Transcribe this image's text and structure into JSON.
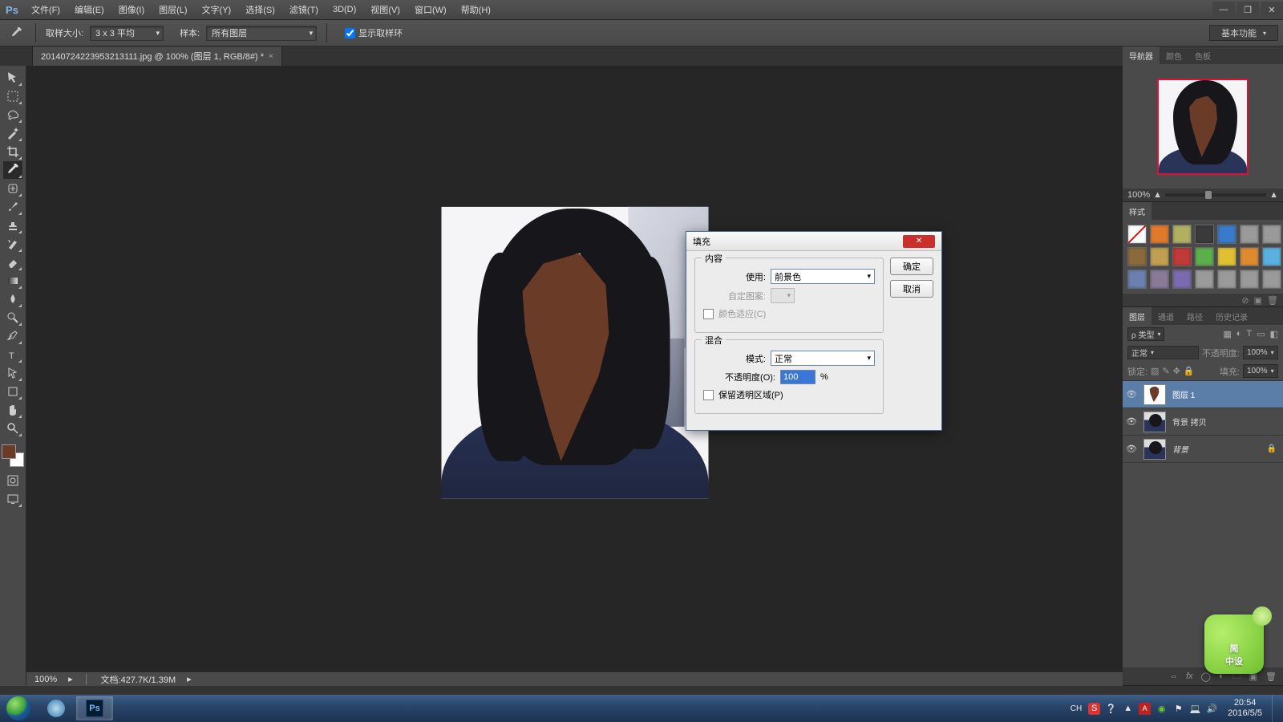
{
  "menubar": {
    "items": [
      "文件(F)",
      "编辑(E)",
      "图像(I)",
      "图层(L)",
      "文字(Y)",
      "选择(S)",
      "滤镜(T)",
      "3D(D)",
      "视图(V)",
      "窗口(W)",
      "帮助(H)"
    ]
  },
  "options_bar": {
    "sample_size_label": "取样大小:",
    "sample_size_value": "3 x 3 平均",
    "sample_label": "样本:",
    "sample_value": "所有图层",
    "show_ring_label": "显示取样环",
    "show_ring_checked": true,
    "workspace": "基本功能"
  },
  "doc_tab": {
    "title": "20140724223953213111.jpg @ 100% (图层 1, RGB/8#) *"
  },
  "dialog": {
    "title": "填充",
    "ok": "确定",
    "cancel": "取消",
    "group_content": "内容",
    "use_label": "使用:",
    "use_value": "前景色",
    "custom_pattern_label": "自定图案:",
    "color_adapt_label": "颜色适应(C)",
    "group_blend": "混合",
    "mode_label": "模式:",
    "mode_value": "正常",
    "opacity_label": "不透明度(O):",
    "opacity_value": "100",
    "opacity_pct": "%",
    "preserve_trans_label": "保留透明区域(P)"
  },
  "navigator": {
    "tabs": [
      "导航器",
      "颜色",
      "色板"
    ],
    "zoom": "100%"
  },
  "styles": {
    "tabs": [
      "样式"
    ],
    "colors": [
      "#ffffff",
      "#e07a2a",
      "#b0b060",
      "#3a3a3a",
      "#3a7acc",
      "#9a9a9a",
      "#9a9a9a",
      "#8a6a3a",
      "#c0a050",
      "#c03a3a",
      "#5ab04a",
      "#e0c030",
      "#e08a30",
      "#5ab0e0",
      "#6a80b0",
      "#8a7a9a",
      "#7a6ab0",
      "#9a9a9a",
      "#9a9a9a",
      "#9a9a9a",
      "#9a9a9a"
    ]
  },
  "layers": {
    "tabs": [
      "图层",
      "通道",
      "路径",
      "历史记录"
    ],
    "kind_label": "ρ 类型",
    "blend_mode": "正常",
    "opacity_label": "不透明度:",
    "opacity_value": "100%",
    "lock_label": "锁定:",
    "fill_label": "填充:",
    "fill_value": "100%",
    "items": [
      {
        "name": "图层 1",
        "thumb": "face",
        "selected": true,
        "locked": false,
        "visible": true,
        "italic": false
      },
      {
        "name": "背景 拷贝",
        "thumb": "photo",
        "selected": false,
        "locked": false,
        "visible": true,
        "italic": false
      },
      {
        "name": "背景",
        "thumb": "photo",
        "selected": false,
        "locked": true,
        "visible": true,
        "italic": true
      }
    ]
  },
  "status": {
    "zoom": "100%",
    "doc_label": "文档:",
    "doc_value": "427.7K/1.39M"
  },
  "taskbar": {
    "lang": "CH",
    "time": "20:54",
    "date": "2016/5/5"
  },
  "widget": {
    "text": "简\n中设"
  },
  "colors": {
    "foreground": "#6a3c28",
    "background": "#ffffff",
    "accent": "#5b7ea8"
  }
}
